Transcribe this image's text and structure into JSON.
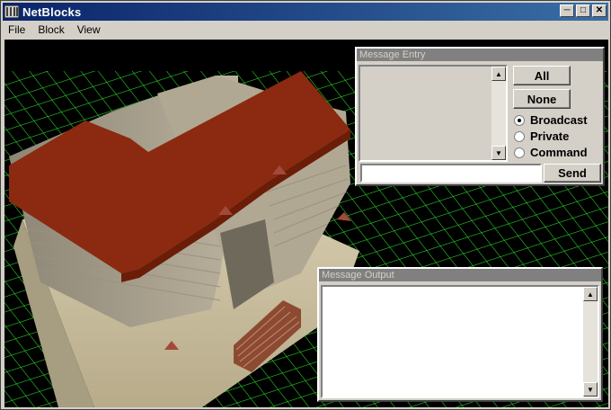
{
  "window": {
    "title": "NetBlocks"
  },
  "menu": {
    "items": [
      "File",
      "Block",
      "View"
    ]
  },
  "message_entry": {
    "title": "Message Entry",
    "buttons": {
      "all": "All",
      "none": "None",
      "send": "Send"
    },
    "radio_options": [
      "Broadcast",
      "Private",
      "Command"
    ],
    "selected_option": "Broadcast",
    "input_value": ""
  },
  "message_output": {
    "title": "Message Output"
  },
  "colors": {
    "titlebar": "#0a246a",
    "grid": "#2bd92b",
    "roof": "#8b2a10",
    "wall": "#b6ad98"
  }
}
